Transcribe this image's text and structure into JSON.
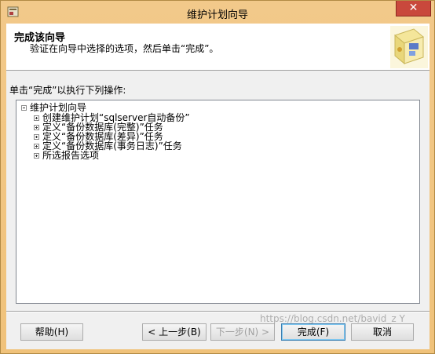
{
  "window": {
    "title": "维护计划向导",
    "close_glyph": "✕"
  },
  "header": {
    "title": "完成该向导",
    "subtitle": "验证在向导中选择的选项，然后单击“完成”。"
  },
  "section_label": "单击“完成”以执行下列操作:",
  "tree": {
    "root": "维护计划向导",
    "items": [
      "创建维护计划“sqlserver自动备份”",
      "定义“备份数据库(完整)”任务",
      "定义“备份数据库(差异)”任务",
      "定义“备份数据库(事务日志)”任务",
      "所选报告选项"
    ]
  },
  "buttons": {
    "help": "帮助(H)",
    "back": "< 上一步(B)",
    "next": "下一步(N) >",
    "finish": "完成(F)",
    "cancel": "取消"
  },
  "watermark": "https://blog.csdn.net/bavid_z Y"
}
